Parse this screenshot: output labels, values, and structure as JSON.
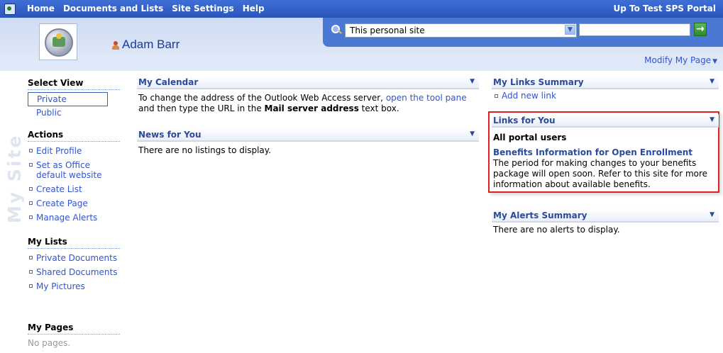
{
  "topbar": {
    "nav": [
      "Home",
      "Documents and Lists",
      "Site Settings",
      "Help"
    ],
    "portal_link": "Up To Test SPS Portal"
  },
  "header": {
    "user_name": "Adam Barr",
    "search_scope": "This personal site",
    "search_value": "",
    "go_label": "→",
    "modify_page": "Modify My Page"
  },
  "leftnav": {
    "watermark": "My Site",
    "select_view": {
      "heading": "Select View",
      "options": [
        "Private",
        "Public"
      ],
      "selected": "Private"
    },
    "actions": {
      "heading": "Actions",
      "items": [
        "Edit Profile",
        "Set as Office default website",
        "Create List",
        "Create Page",
        "Manage Alerts"
      ]
    },
    "my_lists": {
      "heading": "My Lists",
      "items": [
        "Private Documents",
        "Shared Documents",
        "My Pictures"
      ]
    },
    "my_pages": {
      "heading": "My Pages",
      "empty_text": "No pages."
    }
  },
  "webparts": {
    "calendar": {
      "title": "My Calendar",
      "text_before": "To change the address of the Outlook Web Access server, ",
      "link": "open the tool pane",
      "text_mid": " and then type the URL in the ",
      "bold": "Mail server address",
      "text_after": " text box."
    },
    "news": {
      "title": "News for You",
      "body": "There are no listings to display."
    },
    "links_summary": {
      "title": "My Links Summary",
      "add_link": "Add new link"
    },
    "links_for_you": {
      "title": "Links for You",
      "group": "All portal users",
      "link_title": "Benefits Information for Open Enrollment",
      "description": "The period for making changes to your benefits package will open soon. Refer to this site for more information about available benefits."
    },
    "alerts": {
      "title": "My Alerts Summary",
      "body": "There are no alerts to display."
    }
  },
  "colors": {
    "topbar": "#2a55b8",
    "link": "#3355cc",
    "webpart_title": "#2b4a9c",
    "highlight": "#e02020"
  }
}
